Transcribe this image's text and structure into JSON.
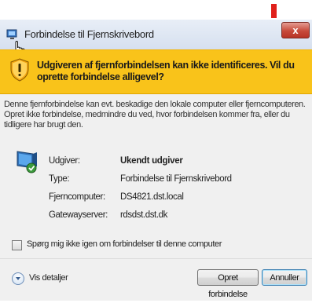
{
  "window": {
    "title": "Forbindelse til Fjernskrivebord",
    "close_label": "x"
  },
  "warning": {
    "text": "Udgiveren af fjernforbindelsen kan ikke identificeres. Vil du oprette forbindelse alligevel?"
  },
  "description": "Denne fjernforbindelse kan evt. beskadige den lokale computer eller fjerncomputeren. Opret ikke forbindelse, medmindre du ved, hvor forbindelsen kommer fra, eller du tidligere har brugt den.",
  "details": {
    "publisher_label": "Udgiver:",
    "publisher_value": "Ukendt udgiver",
    "type_label": "Type:",
    "type_value": "Forbindelse til Fjernskrivebord",
    "remote_label": "Fjerncomputer:",
    "remote_value": "DS4821.dst.local",
    "gateway_label": "Gatewayserver:",
    "gateway_value": "rdsdst.dst.dk"
  },
  "checkbox": {
    "label": "Spørg mig ikke igen om forbindelser til denne computer",
    "checked": false
  },
  "footer": {
    "details_label": "Vis detaljer",
    "connect_label": "Opret forbindelse",
    "cancel_label": "Annuller"
  },
  "colors": {
    "warning_banner": "#f9c31a",
    "red_marker": "#e0201b",
    "close_button": "#c74a3b"
  },
  "icons": {
    "app": "remote-desktop-icon",
    "warning": "warning-shield-icon",
    "computer": "computer-icon",
    "cursor": "hand-cursor-icon",
    "details": "chevron-down-icon"
  }
}
